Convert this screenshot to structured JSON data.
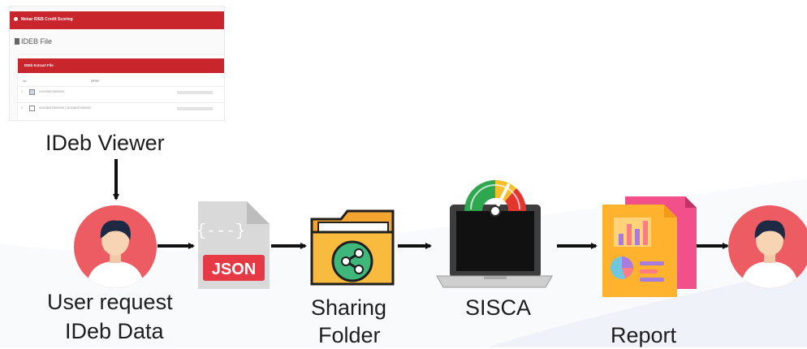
{
  "screenshot": {
    "app_title": "Mekar IDEB Credit Scoring",
    "page_title": "IDEB File",
    "panel_title": "IDEb Extract File",
    "columns": [
      "No.",
      "NPWP",
      ""
    ],
    "rows": [
      {
        "no": "1",
        "checked": true,
        "id": "0101190474000094"
      },
      {
        "no": "2",
        "checked": false,
        "id": "0101180474000005 | 0101180474000007"
      }
    ]
  },
  "labels": {
    "viewer": "IDeb Viewer",
    "user_request_1": "User request",
    "user_request_2": "IDeb Data",
    "sharing_1": "Sharing",
    "sharing_2": "Folder",
    "sisca": "SISCA",
    "report": "Report"
  },
  "icons": {
    "user": "user-avatar-icon",
    "json": "json-file-icon",
    "folder": "shared-folder-icon",
    "laptop": "laptop-gauge-icon",
    "report": "report-document-icon",
    "json_text": "JSON",
    "json_brace": "{---}"
  },
  "colors": {
    "avatar_bg": "#ee5c63",
    "json_red": "#e63946",
    "folder": "#f8b63b",
    "share": "#3fb67a",
    "report_pink": "#f1508a"
  }
}
